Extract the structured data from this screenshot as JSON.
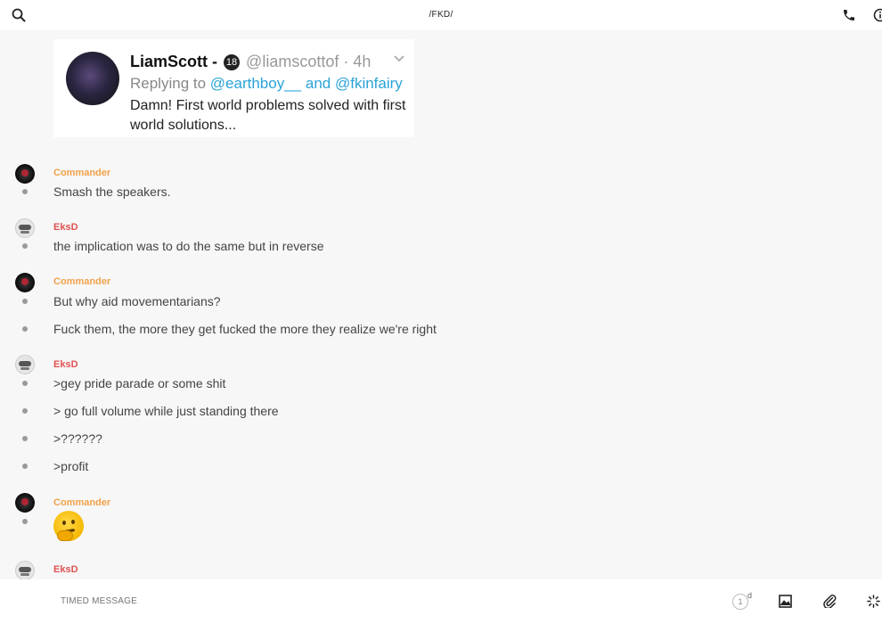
{
  "header": {
    "title": "/FKD/",
    "icons": [
      "search-icon",
      "phone-icon",
      "info-icon"
    ]
  },
  "tweet": {
    "name": "LiamScott -",
    "badge": "18",
    "handle_time": "@liamscottof · 4h",
    "replying_prefix": "Replying to",
    "mention1": "@earthboy__",
    "and": "and",
    "mention2": "@fkinfairy",
    "body": "Damn! First world problems solved with first world solutions..."
  },
  "messages": [
    {
      "author": "Commander",
      "lines": [
        "Smash the speakers."
      ]
    },
    {
      "author": "EksD",
      "lines": [
        "the implication was to do the same but in reverse"
      ]
    },
    {
      "author": "Commander",
      "lines": [
        "But why aid movementarians?",
        "Fuck them, the more they get fucked the more they realize we're right"
      ]
    },
    {
      "author": "EksD",
      "lines": [
        ">gey pride parade or some shit",
        "> go full volume while just standing there",
        ">??????",
        ">profit"
      ]
    },
    {
      "author": "Commander",
      "lines": [
        "thinking-face-emoji"
      ]
    },
    {
      "author": "EksD",
      "lines": []
    }
  ],
  "composer": {
    "placeholder": "TIMED MESSAGE",
    "timer_value": "1",
    "timer_unit": "d",
    "icons": [
      "image-icon",
      "paperclip-icon",
      "loading-spinner-icon"
    ]
  },
  "colors": {
    "commander": "#f0a24a",
    "eksd": "#e05252",
    "mention": "#2aa3d8"
  }
}
